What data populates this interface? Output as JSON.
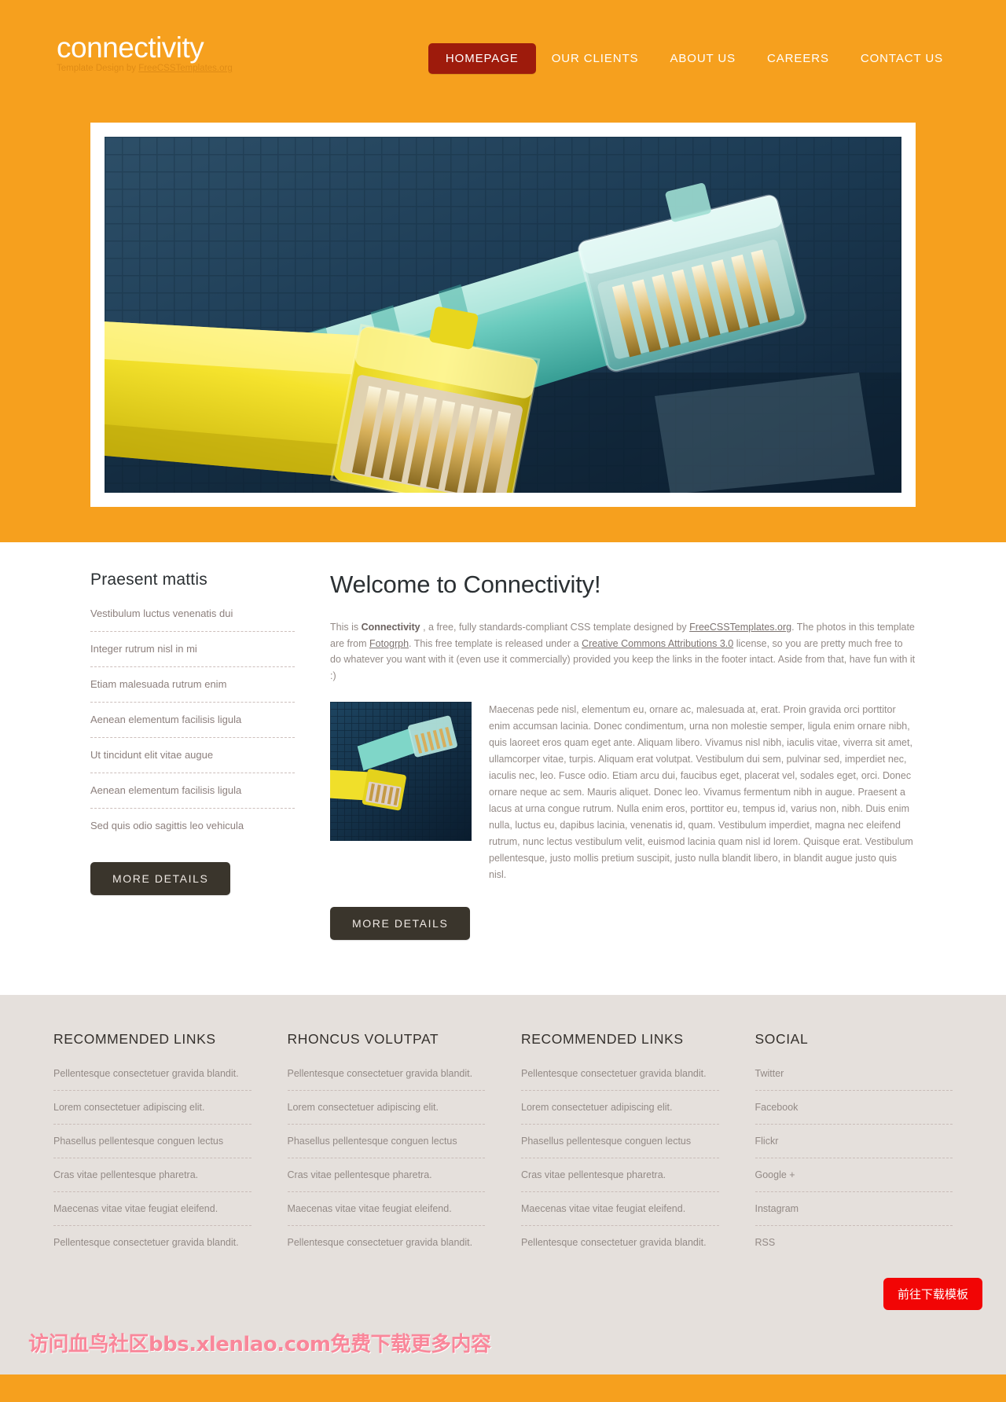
{
  "header": {
    "brand_title": "connectivity",
    "brand_sub_prefix": "Template Design by ",
    "brand_sub_link": "FreeCSSTemplates.org",
    "nav": [
      {
        "label": "HOMEPAGE",
        "active": true
      },
      {
        "label": "OUR CLIENTS",
        "active": false
      },
      {
        "label": "ABOUT US",
        "active": false
      },
      {
        "label": "CAREERS",
        "active": false
      },
      {
        "label": "CONTACT US",
        "active": false
      }
    ]
  },
  "hero": {
    "alt": "Close-up of a yellow and a teal ethernet RJ45 cable connector"
  },
  "sidebar": {
    "title": "Praesent mattis",
    "items": [
      "Vestibulum luctus venenatis dui",
      "Integer rutrum nisl in mi",
      "Etiam malesuada rutrum enim",
      "Aenean elementum facilisis ligula",
      "Ut tincidunt elit vitae augue",
      "Aenean elementum facilisis ligula",
      "Sed quis odio sagittis leo vehicula"
    ],
    "more_button": "MORE DETAILS"
  },
  "main": {
    "title": "Welcome to Connectivity!",
    "intro": {
      "p1": "This is ",
      "brand": "Connectivity",
      "p2": " , a free, fully standards-compliant CSS template designed by ",
      "link1": "FreeCSSTemplates.org",
      "p3": ". The photos in this template are from ",
      "link2": "Fotogrph",
      "p4": ". This free template is released under a ",
      "link3": "Creative Commons Attributions 3.0",
      "p5": " license, so you are pretty much free to do whatever you want with it (even use it commercially) provided you keep the links in the footer intact. Aside from that, have fun with it :)"
    },
    "body_text": "Maecenas pede nisl, elementum eu, ornare ac, malesuada at, erat. Proin gravida orci porttitor enim accumsan lacinia. Donec condimentum, urna non molestie semper, ligula enim ornare nibh, quis laoreet eros quam eget ante. Aliquam libero. Vivamus nisl nibh, iaculis vitae, viverra sit amet, ullamcorper vitae, turpis. Aliquam erat volutpat. Vestibulum dui sem, pulvinar sed, imperdiet nec, iaculis nec, leo. Fusce odio. Etiam arcu dui, faucibus eget, placerat vel, sodales eget, orci. Donec ornare neque ac sem. Mauris aliquet. Donec leo. Vivamus fermentum nibh in augue. Praesent a lacus at urna congue rutrum. Nulla enim eros, porttitor eu, tempus id, varius non, nibh. Duis enim nulla, luctus eu, dapibus lacinia, venenatis id, quam. Vestibulum imperdiet, magna nec eleifend rutrum, nunc lectus vestibulum velit, euismod lacinia quam nisl id lorem. Quisque erat. Vestibulum pellentesque, justo mollis pretium suscipit, justo nulla blandit libero, in blandit augue justo quis nisl.",
    "more_button": "MORE DETAILS",
    "thumb_alt": "Ethernet cable connectors thumbnail"
  },
  "footer": {
    "columns": [
      {
        "heading": "RECOMMENDED LINKS",
        "items": [
          "Pellentesque consectetuer gravida blandit.",
          "Lorem consectetuer adipiscing elit.",
          "Phasellus pellentesque conguen lectus",
          "Cras vitae pellentesque pharetra.",
          "Maecenas vitae vitae feugiat eleifend.",
          "Pellentesque consectetuer gravida blandit."
        ]
      },
      {
        "heading": "RHONCUS VOLUTPAT",
        "items": [
          "Pellentesque consectetuer gravida blandit.",
          "Lorem consectetuer adipiscing elit.",
          "Phasellus pellentesque conguen lectus",
          "Cras vitae pellentesque pharetra.",
          "Maecenas vitae vitae feugiat eleifend.",
          "Pellentesque consectetuer gravida blandit."
        ]
      },
      {
        "heading": "RECOMMENDED LINKS",
        "items": [
          "Pellentesque consectetuer gravida blandit.",
          "Lorem consectetuer adipiscing elit.",
          "Phasellus pellentesque conguen lectus",
          "Cras vitae pellentesque pharetra.",
          "Maecenas vitae vitae feugiat eleifend.",
          "Pellentesque consectetuer gravida blandit."
        ]
      },
      {
        "heading": "SOCIAL",
        "items": [
          "Twitter",
          "Facebook",
          "Flickr",
          "Google +",
          "Instagram",
          "RSS"
        ]
      }
    ],
    "watermark": "访问血鸟社区bbs.xlenlao.com免费下载更多内容",
    "download_button": "前往下载模板"
  },
  "colors": {
    "brand_orange": "#f6a01e",
    "nav_active": "#9e1b0c",
    "button_dark": "#3a352c",
    "footer_bg": "#e5e0dc",
    "download_red": "#f20505",
    "watermark_pink": "#f9879a"
  }
}
